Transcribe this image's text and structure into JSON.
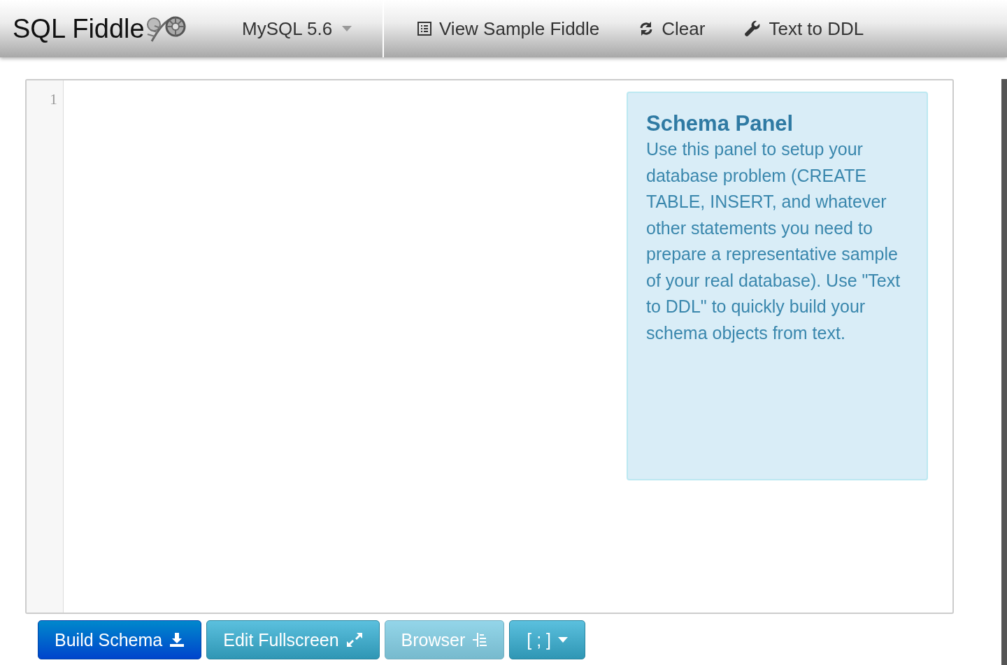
{
  "navbar": {
    "brand": "SQL Fiddle",
    "database_selector": "MySQL 5.6",
    "menu": [
      {
        "label": "View Sample Fiddle"
      },
      {
        "label": "Clear"
      },
      {
        "label": "Text to DDL"
      }
    ]
  },
  "editor": {
    "line_numbers": [
      "1"
    ]
  },
  "schema_panel": {
    "title": "Schema Panel",
    "text": "Use this panel to setup your database problem (CREATE TABLE, INSERT, and whatever other statements you need to prepare a representative sample of your real database). Use \"Text to DDL\" to quickly build your schema objects from text."
  },
  "buttons": [
    {
      "label": "Build Schema",
      "kind": "primary",
      "disabled": false
    },
    {
      "label": "Edit Fullscreen",
      "kind": "info",
      "disabled": false
    },
    {
      "label": "Browser",
      "kind": "info",
      "disabled": true
    },
    {
      "label": "[ ; ]",
      "kind": "dropdown",
      "disabled": false
    }
  ]
}
